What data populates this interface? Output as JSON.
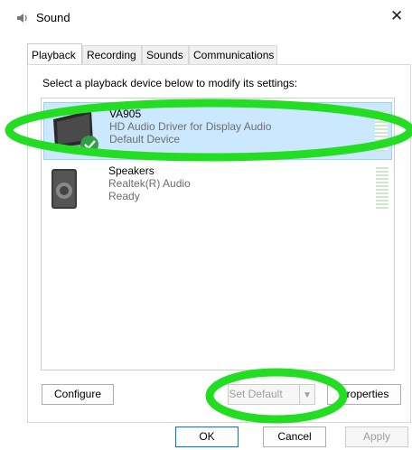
{
  "window": {
    "title": "Sound",
    "close_icon": "close-icon"
  },
  "tabs": [
    {
      "label": "Playback",
      "active": true
    },
    {
      "label": "Recording"
    },
    {
      "label": "Sounds"
    },
    {
      "label": "Communications"
    }
  ],
  "instruction": "Select a playback device below to modify its settings:",
  "devices": [
    {
      "name": "VA905",
      "driver": "HD Audio Driver for Display Audio",
      "status": "Default Device",
      "icon": "monitor-icon",
      "selected": true
    },
    {
      "name": "Speakers",
      "driver": "Realtek(R) Audio",
      "status": "Ready",
      "icon": "speaker-icon"
    }
  ],
  "buttons": {
    "configure": "Configure",
    "set_default": "Set Default",
    "properties": "Properties",
    "ok": "OK",
    "cancel": "Cancel",
    "apply": "Apply"
  },
  "annotation_color": "#22dd22"
}
